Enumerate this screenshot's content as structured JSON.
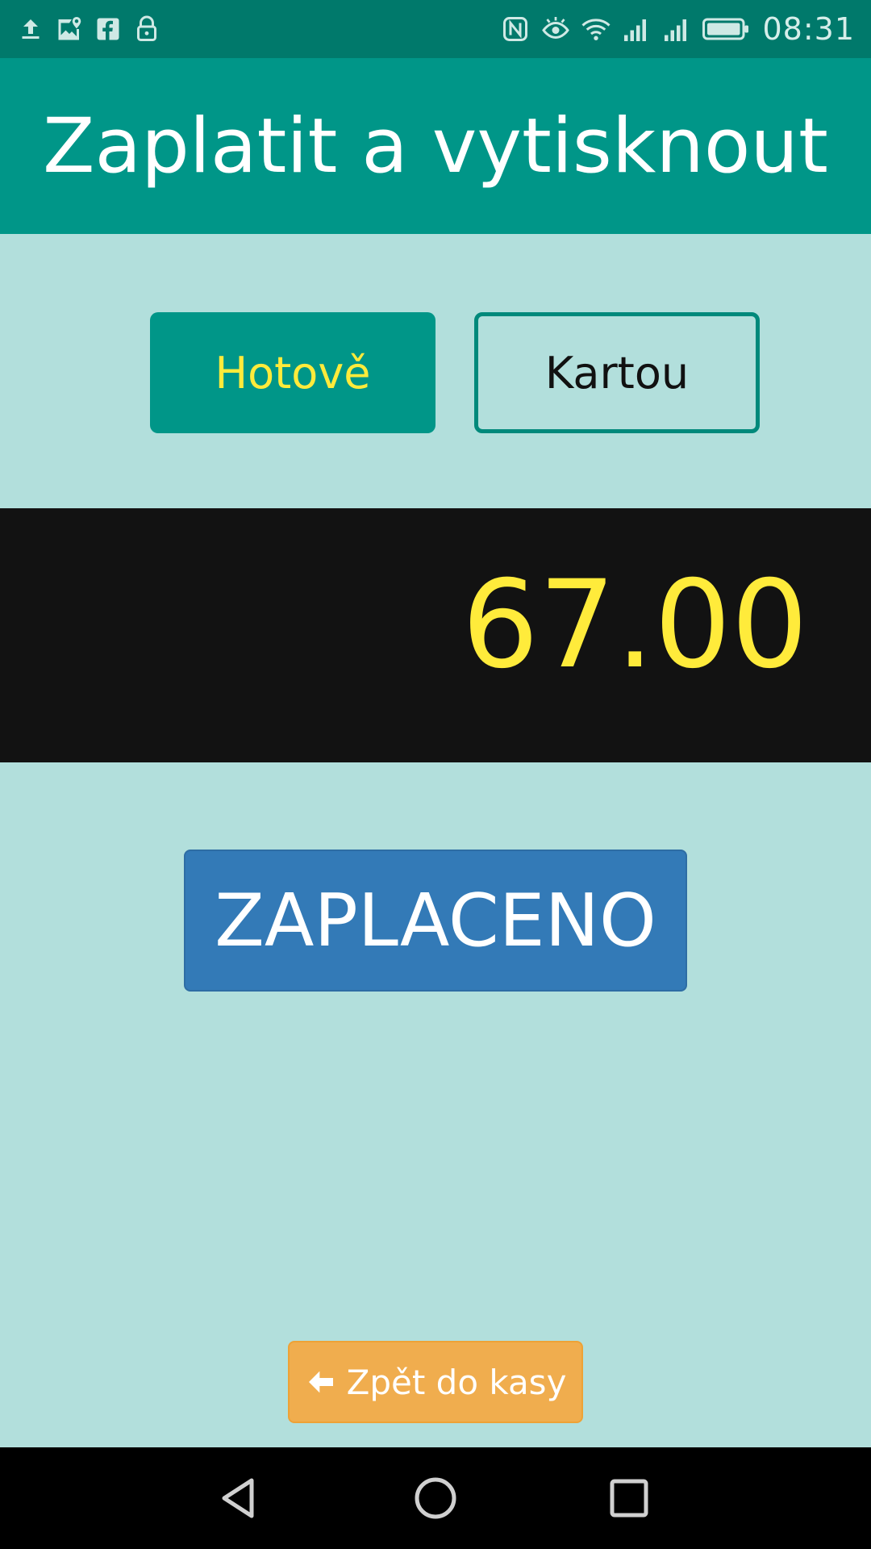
{
  "status_bar": {
    "time": "08:31",
    "left_icons": [
      "upload-icon",
      "maps-icon",
      "facebook-icon",
      "lock-icon"
    ],
    "right_icons": [
      "nfc-icon",
      "eye-icon",
      "wifi-icon",
      "signal-icon",
      "signal-icon",
      "battery-icon"
    ]
  },
  "app_bar": {
    "title": "Zaplatit a vytisknout"
  },
  "payment_methods": {
    "cash_label": "Hotově",
    "card_label": "Kartou",
    "selected": "cash"
  },
  "amount": {
    "value": "67.00"
  },
  "actions": {
    "paid_label": "ZAPLACENO",
    "back_label": "Zpět do kasy",
    "back_icon": "arrow-left-icon"
  },
  "colors": {
    "primary": "#009688",
    "primary_dark": "#00796b",
    "background": "#b2dfdc",
    "amount_text": "#ffeb3b",
    "paid_button": "#337ab7",
    "back_button": "#f0ad4e"
  },
  "nav_bar": {
    "icons": [
      "back-triangle-icon",
      "home-circle-icon",
      "recents-square-icon"
    ]
  }
}
